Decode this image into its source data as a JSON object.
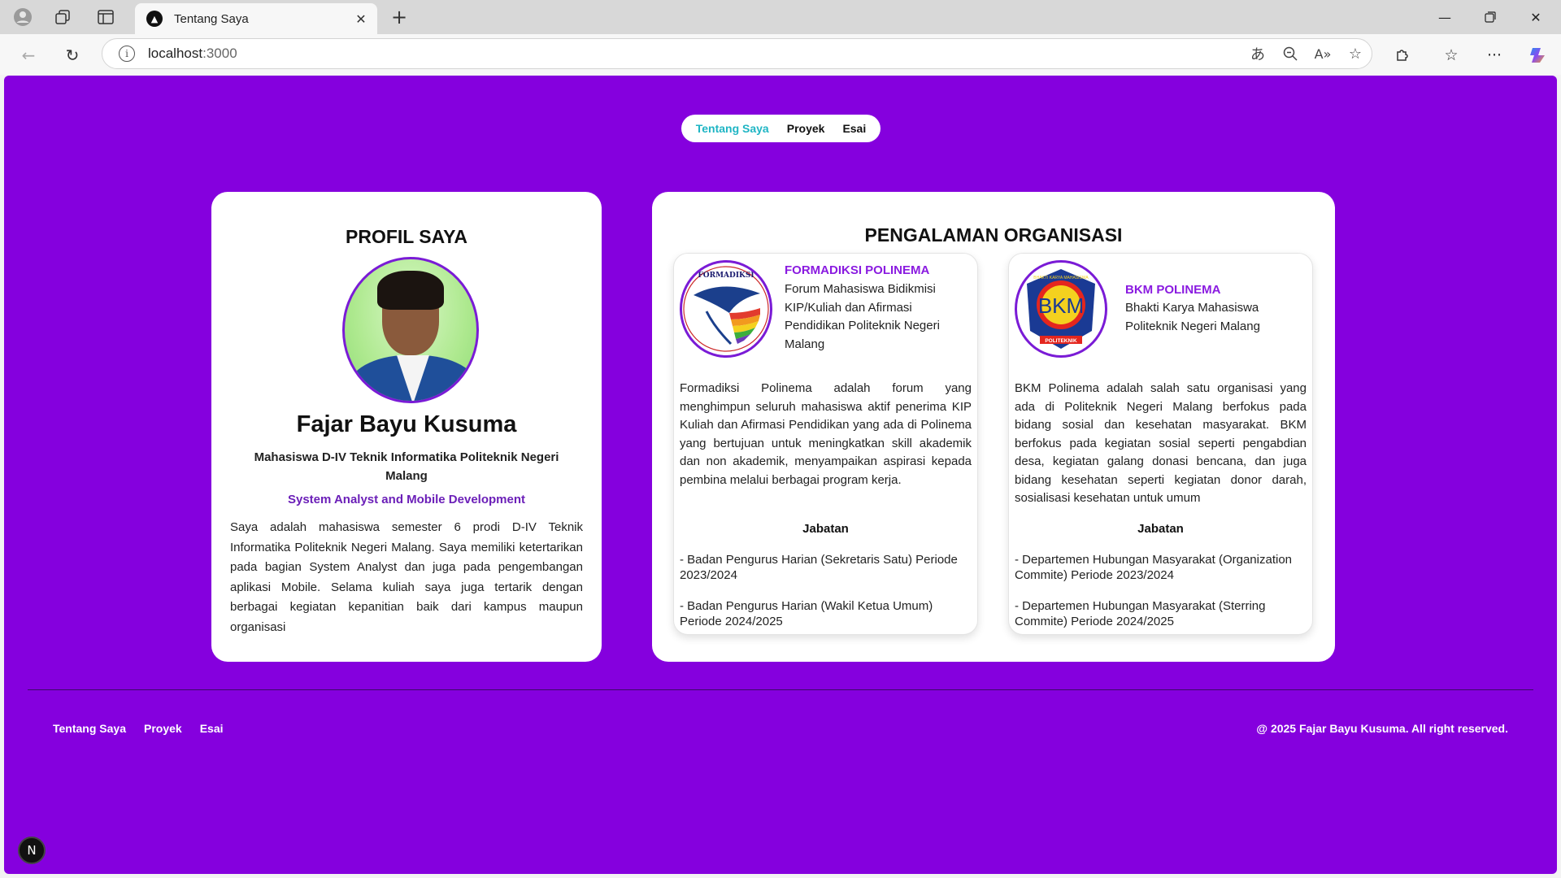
{
  "browser": {
    "tab_title": "Tentang Saya",
    "url_host": "localhost",
    "url_port": ":3000",
    "icons": [
      "profile-icon",
      "collections-icon",
      "tab-actions-icon",
      "close-icon",
      "new-tab-icon",
      "minimize-icon",
      "restore-icon",
      "close-window-icon",
      "back-icon",
      "refresh-icon",
      "info-icon",
      "translate-icon",
      "zoom-out-icon",
      "read-aloud-icon",
      "favorite-icon",
      "extensions-icon",
      "favorites-icon",
      "more-icon",
      "copilot-icon"
    ]
  },
  "nav": {
    "items": [
      {
        "label": "Tentang Saya",
        "active": true
      },
      {
        "label": "Proyek",
        "active": false
      },
      {
        "label": "Esai",
        "active": false
      }
    ],
    "active_color": "#1fb5c4"
  },
  "profile": {
    "section_title": "PROFIL SAYA",
    "name": "Fajar Bayu Kusuma",
    "role": "Mahasiswa D-IV Teknik Informatika Politeknik Negeri Malang",
    "specialty": "System Analyst and Mobile Development",
    "bio": "Saya adalah mahasiswa semester 6 prodi D-IV Teknik Informatika Politeknik Negeri Malang. Saya memiliki ketertarikan pada bagian System Analyst dan juga pada pengembangan aplikasi Mobile. Selama kuliah saya juga tertarik dengan berbagai kegiatan kepanitian baik dari kampus maupun organisasi"
  },
  "organizations": {
    "section_title": "PENGALAMAN ORGANISASI",
    "items": [
      {
        "name": "FORMADIKSI POLINEMA",
        "subtitle": "Forum Mahasiswa Bidikmisi KIP/Kuliah dan Afirmasi Pendidikan Politeknik Negeri Malang",
        "logo_text": "FORMADIKSI",
        "description": "Formadiksi Polinema adalah forum yang menghimpun seluruh mahasiswa aktif penerima KIP Kuliah dan Afirmasi Pendidikan yang ada di Polinema yang bertujuan untuk meningkatkan skill akademik dan non akademik, menyampaikan aspirasi kepada pembina melalui berbagai program kerja.",
        "jabatan_title": "Jabatan",
        "positions": [
          "- Badan Pengurus Harian (Sekretaris Satu) Periode 2023/2024",
          "- Badan Pengurus Harian (Wakil Ketua Umum) Periode 2024/2025"
        ]
      },
      {
        "name": "BKM POLINEMA",
        "subtitle": "Bhakti Karya Mahasiswa Politeknik Negeri Malang",
        "logo_text": "BKM",
        "logo_ring_text": "BHAKTI KARYA MAHASISWA",
        "logo_bottom_text": "POLITEKNIK",
        "description": "BKM Polinema adalah salah satu organisasi yang ada di Politeknik Negeri Malang berfokus pada bidang sosial dan kesehatan masyarakat. BKM berfokus pada kegiatan sosial seperti pengabdian desa, kegiatan galang donasi bencana, dan juga bidang kesehatan seperti kegiatan donor darah, sosialisasi kesehatan untuk umum",
        "jabatan_title": "Jabatan",
        "positions": [
          "- Departemen Hubungan Masyarakat (Organization Commite) Periode 2023/2024",
          "- Departemen Hubungan Masyarakat (Sterring Commite) Periode 2024/2025"
        ]
      }
    ]
  },
  "footer": {
    "links": [
      "Tentang Saya",
      "Proyek",
      "Esai"
    ],
    "copyright": "@ 2025 Fajar Bayu Kusuma. All right reserved."
  },
  "next_badge": "N",
  "colors": {
    "page_bg": "#8500de",
    "accent_purple": "#8a1be0"
  }
}
